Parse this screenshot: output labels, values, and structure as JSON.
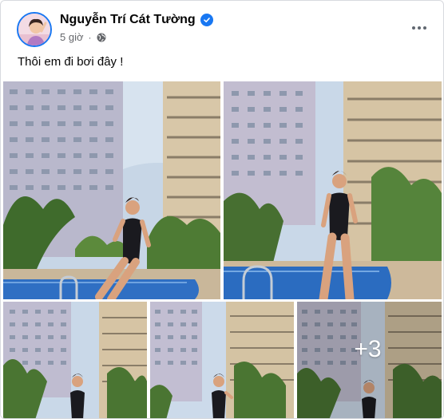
{
  "post": {
    "author": {
      "name": "Nguyễn Trí Cát Tường",
      "verified": true,
      "avatar_icon": "avatar-photo"
    },
    "timestamp": "5 giờ",
    "separator": "·",
    "audience_icon": "globe-icon",
    "more_icon": "ellipsis-icon",
    "caption": "Thôi em đi bơi đây !",
    "photos": {
      "visible_count": 5,
      "overflow_label": "+3"
    }
  },
  "colors": {
    "brand_blue": "#1877f2",
    "secondary_text": "#65676b",
    "primary_text": "#050505"
  }
}
